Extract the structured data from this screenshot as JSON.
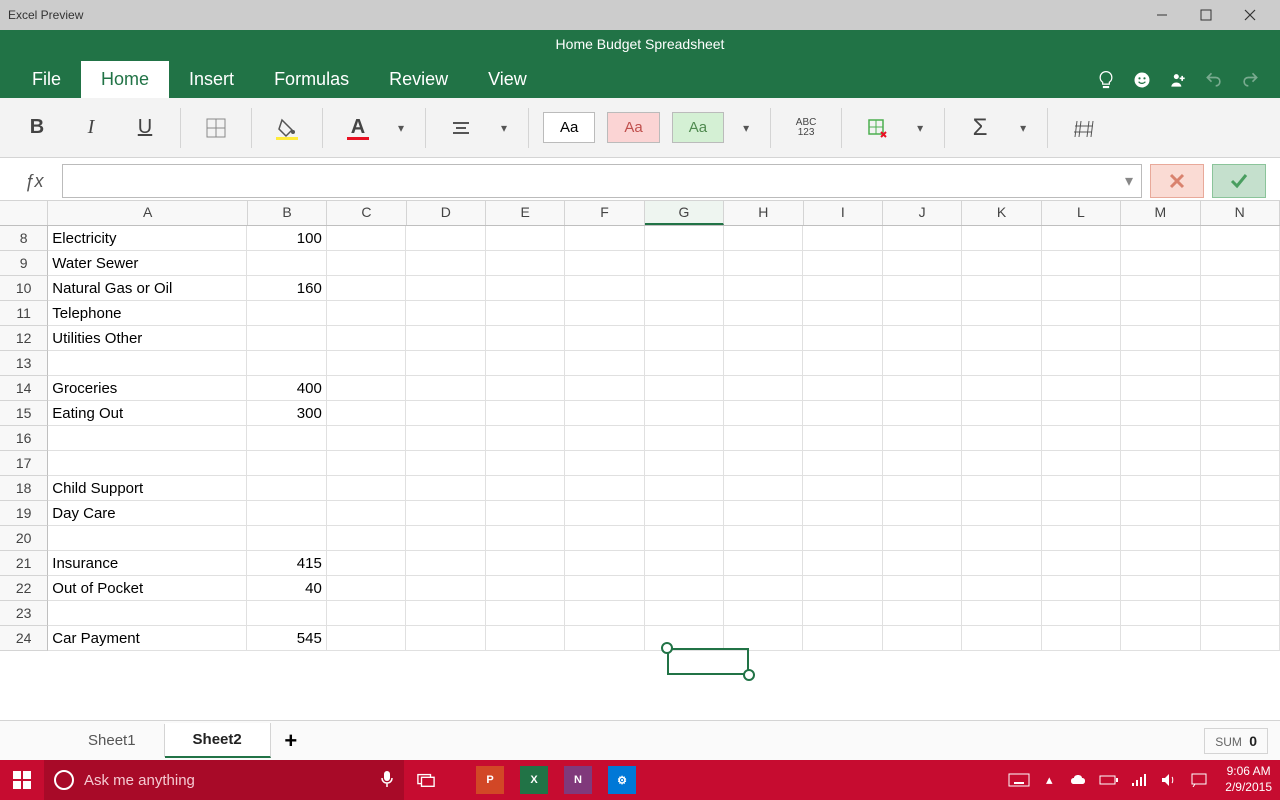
{
  "window": {
    "title": "Excel Preview"
  },
  "document": {
    "title": "Home Budget Spreadsheet"
  },
  "tabs": {
    "file": "File",
    "home": "Home",
    "insert": "Insert",
    "formulas": "Formulas",
    "review": "Review",
    "view": "View"
  },
  "ribbon": {
    "style_normal": "Aa",
    "style_bad": "Aa",
    "style_good": "Aa",
    "numfmt_top": "ABC",
    "numfmt_bot": "123"
  },
  "formula": {
    "value": ""
  },
  "columns": [
    "A",
    "B",
    "C",
    "D",
    "E",
    "F",
    "G",
    "H",
    "I",
    "J",
    "K",
    "L",
    "M",
    "N"
  ],
  "selected_col": "G",
  "rows": [
    {
      "n": 8,
      "a": "Electricity",
      "b": "100"
    },
    {
      "n": 9,
      "a": "Water Sewer",
      "b": ""
    },
    {
      "n": 10,
      "a": "Natural Gas or Oil",
      "b": "160"
    },
    {
      "n": 11,
      "a": "Telephone",
      "b": ""
    },
    {
      "n": 12,
      "a": "Utilities Other",
      "b": ""
    },
    {
      "n": 13,
      "a": "",
      "b": ""
    },
    {
      "n": 14,
      "a": "Groceries",
      "b": "400"
    },
    {
      "n": 15,
      "a": "Eating Out",
      "b": "300"
    },
    {
      "n": 16,
      "a": "",
      "b": ""
    },
    {
      "n": 17,
      "a": "",
      "b": ""
    },
    {
      "n": 18,
      "a": "Child Support",
      "b": ""
    },
    {
      "n": 19,
      "a": "Day Care",
      "b": ""
    },
    {
      "n": 20,
      "a": "",
      "b": ""
    },
    {
      "n": 21,
      "a": "Insurance",
      "b": "415"
    },
    {
      "n": 22,
      "a": "Out of Pocket",
      "b": "40"
    },
    {
      "n": 23,
      "a": "",
      "b": ""
    },
    {
      "n": 24,
      "a": "Car Payment",
      "b": "545"
    }
  ],
  "sheets": {
    "s1": "Sheet1",
    "s2": "Sheet2"
  },
  "status": {
    "sum_label": "SUM",
    "sum_value": "0"
  },
  "taskbar": {
    "search_placeholder": "Ask me anything",
    "time": "9:06 AM",
    "date": "2/9/2015"
  },
  "colors": {
    "brand": "#217346",
    "taskbar": "#c60c30"
  }
}
